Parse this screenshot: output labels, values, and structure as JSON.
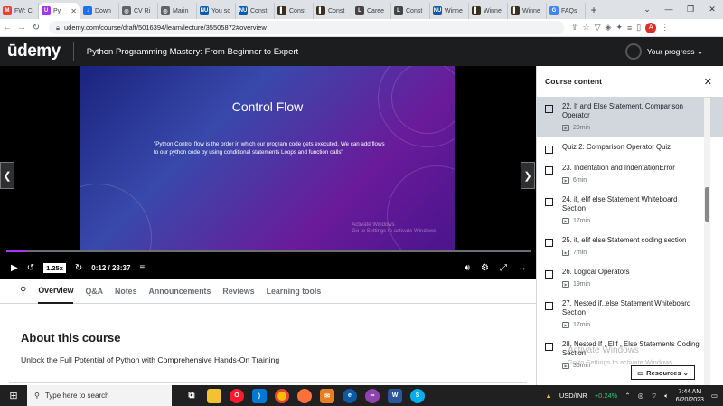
{
  "browser": {
    "tabs": [
      {
        "label": "FW: C",
        "icon": "gmail-icon",
        "color": "#ea4335",
        "glyph": "M"
      },
      {
        "label": "Py",
        "icon": "udemy-icon",
        "color": "#a435f0",
        "glyph": "U",
        "active": true
      },
      {
        "label": "Down",
        "icon": "download-icon",
        "color": "#1a73e8",
        "glyph": "↓"
      },
      {
        "label": "CV Ri",
        "icon": "globe-icon",
        "color": "#5f6368",
        "glyph": "◎"
      },
      {
        "label": "Marin",
        "icon": "globe-icon",
        "color": "#5f6368",
        "glyph": "◎"
      },
      {
        "label": "You sc",
        "icon": "nu-icon",
        "color": "#0b5cad",
        "glyph": "NU"
      },
      {
        "label": "Const",
        "icon": "nu-icon",
        "color": "#0b5cad",
        "glyph": "NU"
      },
      {
        "label": "Const",
        "icon": "page-icon",
        "color": "#3b2f1e",
        "glyph": "▌"
      },
      {
        "label": "Const",
        "icon": "page-icon",
        "color": "#3b2f1e",
        "glyph": "▌"
      },
      {
        "label": "Caree",
        "icon": "linkedin-icon",
        "color": "#444",
        "glyph": "L"
      },
      {
        "label": "Const",
        "icon": "linkedin-icon",
        "color": "#444",
        "glyph": "L"
      },
      {
        "label": "Winne",
        "icon": "nu-icon",
        "color": "#0b5cad",
        "glyph": "NU"
      },
      {
        "label": "Winne",
        "icon": "page-icon",
        "color": "#3b2f1e",
        "glyph": "▌"
      },
      {
        "label": "Winne",
        "icon": "page-icon",
        "color": "#3b2f1e",
        "glyph": "▌"
      },
      {
        "label": "FAQs",
        "icon": "google-icon",
        "color": "#4285f4",
        "glyph": "G"
      }
    ],
    "url": "udemy.com/course/draft/5016394/learn/lecture/35505872#overview",
    "profile_initial": "A"
  },
  "header": {
    "logo": "ūdemy",
    "course_title": "Python Programming Mastery: From Beginner to Expert",
    "progress_label": "Your progress ⌄"
  },
  "slide": {
    "title": "Control Flow",
    "body": "\"Python Control flow is the order in which our program code gets executed. We can add flows to our python code by using conditional statements Loops and function calls\"",
    "watermark_line1": "Activate Windows",
    "watermark_line2": "Go to Settings to activate Windows."
  },
  "player": {
    "speed": "1.25x",
    "time": "0:12 / 28:37",
    "progress_fraction": 0.007
  },
  "nav_tabs": [
    "Overview",
    "Q&A",
    "Notes",
    "Announcements",
    "Reviews",
    "Learning tools"
  ],
  "about": {
    "title": "About this course",
    "subtitle": "Unlock the Full Potential of Python with Comprehensive Hands-On Training"
  },
  "sidebar": {
    "title": "Course content",
    "items": [
      {
        "label": "22. If and Else Statement, Comparison Operator",
        "duration": "29min",
        "selected": true
      },
      {
        "label": "Quiz 2: Comparison Operator Quiz",
        "duration": ""
      },
      {
        "label": "23. Indentation and IndentationError",
        "duration": "6min"
      },
      {
        "label": "24. if, elif else Statement Whiteboard Section",
        "duration": "17min"
      },
      {
        "label": "25. if, elif else Statement coding section",
        "duration": "7min"
      },
      {
        "label": "26. Logical Operators",
        "duration": "19min"
      },
      {
        "label": "27. Nested if..else Statement Whiteboard Section",
        "duration": "17min"
      },
      {
        "label": "28. Nested If , Elif , Else Statements Coding Section",
        "duration": "36min"
      }
    ],
    "resources_label": "Resources ⌄",
    "activate_line1": "Activate Windows",
    "activate_line2": "Go to Settings to activate Windows."
  },
  "taskbar": {
    "search_placeholder": "Type here to search",
    "ticker": "USD/INR",
    "ticker_change": "+0.24%",
    "time": "7:44 AM",
    "date": "6/20/2023"
  }
}
